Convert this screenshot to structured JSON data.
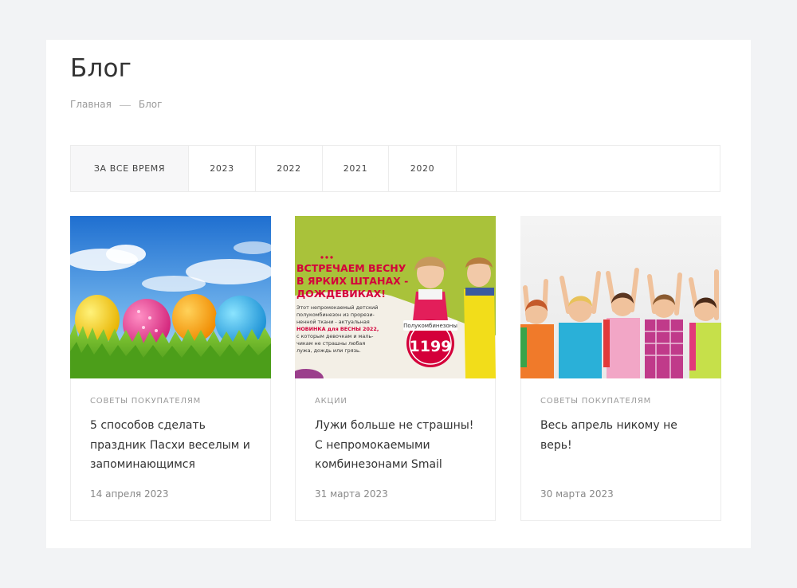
{
  "page": {
    "title": "Блог",
    "breadcrumb": {
      "home": "Главная",
      "current": "Блог"
    }
  },
  "tabs": [
    {
      "label": "За все время",
      "active": true
    },
    {
      "label": "2023",
      "active": false
    },
    {
      "label": "2022",
      "active": false
    },
    {
      "label": "2021",
      "active": false
    },
    {
      "label": "2020",
      "active": false
    }
  ],
  "cards": [
    {
      "category": "Советы покупателям",
      "title": "5 способов сделать праздник Пасхи веселым и запоминающимся",
      "date": "14 апреля 2023",
      "image": "easter-eggs-in-grass"
    },
    {
      "category": "Акции",
      "title": "Лужи больше не страшны! С непромокаемыми комбинезонами Smail",
      "date": "31 марта 2023",
      "image": "raincoat-promo-banner",
      "promo": {
        "heading_line1": "ВСТРЕЧАЕМ ВЕСНУ",
        "heading_line2": "В ЯРКИХ ШТАНАХ -",
        "heading_line3": "ДОЖДЕВИКАХ!",
        "body_line1": "Этот непромокаемый детский",
        "body_line2": "полукомбинезон из прорези-",
        "body_line3": "ненной ткани - актуальная",
        "body_line4": "НОВИНКА для ВЕСНЫ 2022,",
        "body_line5": "с которым девочкам и маль-",
        "body_line6": "чикам не страшны любая",
        "body_line7": "лужа, дождь или грязь.",
        "badge_label": "Полукомбинезоны",
        "price": "1199"
      }
    },
    {
      "category": "Советы покупателям",
      "title": "Весь апрель никому не верь!",
      "date": "30 марта 2023",
      "image": "happy-children-raising-hands"
    }
  ],
  "colors": {
    "page_bg": "#f2f3f5",
    "panel_bg": "#ffffff",
    "promo_green": "#a9c23a",
    "promo_red": "#d4003a"
  }
}
